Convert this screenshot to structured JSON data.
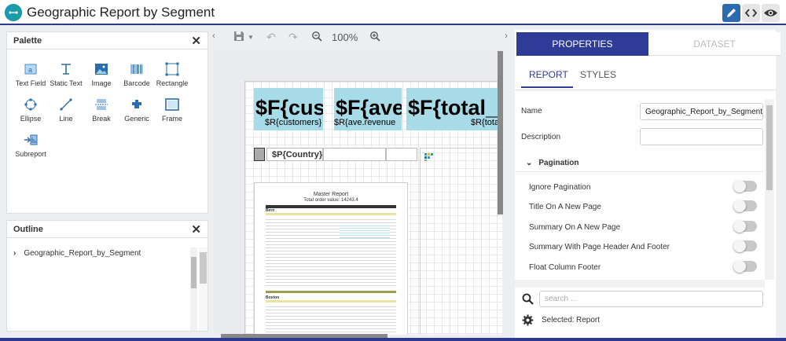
{
  "app": {
    "title": "Geographic Report by Segment",
    "logo_text": "↔"
  },
  "toolbar": {
    "edit_icon": "pencil-icon",
    "code_icon": "code-icon",
    "preview_icon": "eye-icon",
    "accent": "#2b6cb0"
  },
  "palette": {
    "title": "Palette",
    "items": [
      {
        "label": "Text Field",
        "icon": "text-field-icon"
      },
      {
        "label": "Static Text",
        "icon": "static-text-icon"
      },
      {
        "label": "Image",
        "icon": "image-icon"
      },
      {
        "label": "Barcode",
        "icon": "barcode-icon"
      },
      {
        "label": "Rectangle",
        "icon": "rectangle-icon"
      },
      {
        "label": "Ellipse",
        "icon": "ellipse-icon"
      },
      {
        "label": "Line",
        "icon": "line-icon"
      },
      {
        "label": "Break",
        "icon": "break-icon"
      },
      {
        "label": "Generic",
        "icon": "generic-icon"
      },
      {
        "label": "Frame",
        "icon": "frame-icon"
      },
      {
        "label": "Subreport",
        "icon": "subreport-icon"
      }
    ]
  },
  "outline": {
    "title": "Outline",
    "root": "Geographic_Report_by_Segment"
  },
  "canvas": {
    "zoom": "100%",
    "fields": [
      {
        "big": "$F{cust",
        "small": "$R{customers}"
      },
      {
        "big": "$F{ave",
        "small": "$R{ave.revenue"
      },
      {
        "big": "$F{total_re",
        "small": "$R{tota"
      }
    ],
    "group_field": "$P{Country}",
    "subreport": {
      "title": "Master Report",
      "subtitle": "Total order value: 14243.4",
      "rows": [
        "Bern",
        "Boston"
      ]
    }
  },
  "properties": {
    "tabs": [
      "PROPERTIES",
      "DATASET"
    ],
    "subtabs": [
      "REPORT",
      "STYLES"
    ],
    "name_label": "Name",
    "name_value": "Geographic_Report_by_Segment",
    "description_label": "Description",
    "description_value": "",
    "section": "Pagination",
    "toggles": [
      "Ignore Pagination",
      "Title On A New Page",
      "Summary On A New Page",
      "Summary With Page Header And Footer",
      "Float Column Footer"
    ],
    "search_placeholder": "search ...",
    "selected_label": "Selected:",
    "selected_value": "Report"
  }
}
